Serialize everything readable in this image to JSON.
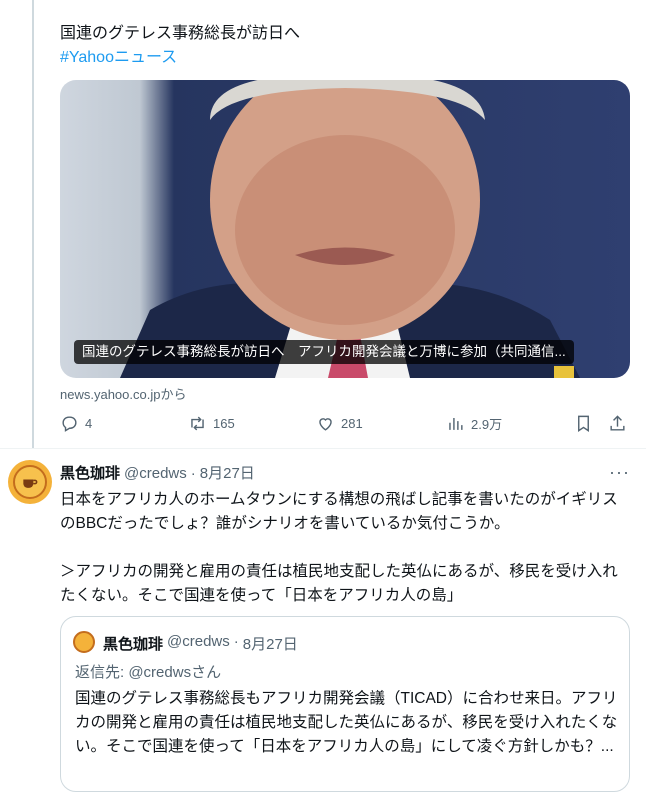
{
  "tweet1": {
    "text": "国連のグテレス事務総長が訪日へ",
    "hashtag": "#Yahooニュース",
    "card_caption": "国連のグテレス事務総長が訪日へ　アフリカ開発会議と万博に参加（共同通信...",
    "source": "news.yahoo.co.jpから",
    "replies": "4",
    "reposts": "165",
    "likes": "281",
    "views": "2.9万"
  },
  "tweet2": {
    "display_name": "黒色珈琲",
    "handle": "@credws",
    "dot": "·",
    "date": "8月27日",
    "more": "···",
    "body": "日本をアフリカ人のホームタウンにする構想の飛ばし記事を書いたのがイギリスのBBCだったでしょ？誰がシナリオを書いているか気付こうか。\n\n＞アフリカの開発と雇用の責任は植民地支配した英仏にあるが、移民を受け入れたくない。そこで国連を使って「日本をアフリカ人の島」",
    "quote": {
      "display_name": "黒色珈琲",
      "handle": "@credws",
      "dot": "·",
      "date": "8月27日",
      "reply_to": "返信先: @credwsさん",
      "body": "国連のグテレス事務総長もアフリカ開発会議（TICAD）に合わせ来日。アフリカの開発と雇用の責任は植民地支配した英仏にあるが、移民を受け入れたくない。そこで国連を使って「日本をアフリカ人の島」にして凌ぐ方針しかも？..."
    }
  },
  "colors": {
    "accent": "#1d9bf0",
    "muted": "#536471",
    "border": "#cfd9de"
  }
}
